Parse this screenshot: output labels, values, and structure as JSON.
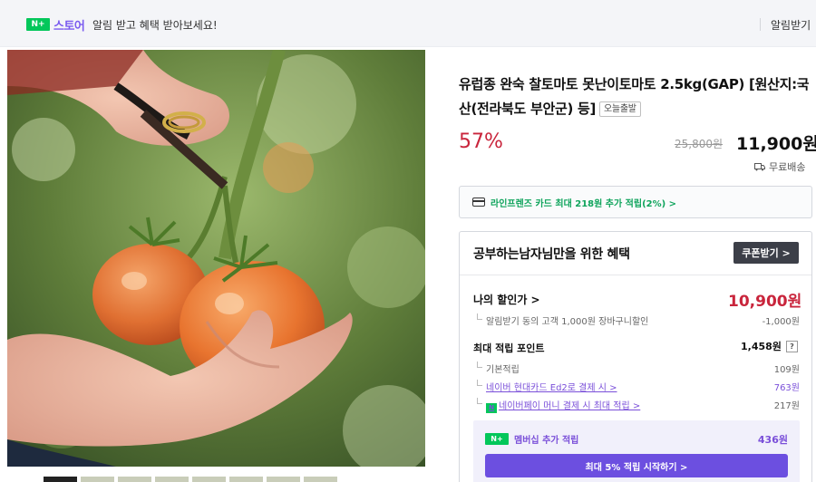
{
  "topbar": {
    "logo_mark": "N+",
    "logo_text": "스토어",
    "message": "알림 받고 혜택 받아보세요!",
    "right_link": "알림받기"
  },
  "product": {
    "title": "유럽종 완숙 찰토마토 못난이토마토 2.5kg(GAP) [원산지:국산(전라북도 부안군) 등]",
    "badge": "오늘출발",
    "discount_rate": "57%",
    "original_price": "25,800원",
    "price": "11,900원",
    "shipping": "무료배송"
  },
  "card_promo": "라인프렌즈 카드 최대 218원 추가 적립(2%) >",
  "benefit": {
    "title": "공부하는남자님만을 위한 혜택",
    "coupon_button": "쿠폰받기 >",
    "my_price_label": "나의 할인가 >",
    "my_price": "10,900원",
    "discount_row": {
      "label": "알림받기 동의 고객 1,000원 장바구니할인",
      "value": "-1,000원"
    },
    "points_label": "최대 적립 포인트",
    "points_total": "1,458원",
    "points_help": "?",
    "point_rows": [
      {
        "label": "기본적립",
        "value": "109원"
      },
      {
        "label": "네이버 현대카드 Ed2로 결제 시 >",
        "value": "763원"
      },
      {
        "label": "네이버페이 머니 결제 시 최대 적립 >",
        "value": "217원"
      }
    ],
    "npay_mini_mark": "N",
    "membership": {
      "mark": "N+",
      "label": "멤버십 추가 적립",
      "points": "436원",
      "button": "최대 5% 적립 시작하기 >"
    }
  },
  "colors": {
    "naver_green": "#03c75a",
    "store_purple": "#7a5bf0",
    "discount_red": "#c9253c",
    "membership_purple": "#6c4fe0"
  },
  "icons": [
    "ticket-icon",
    "card-icon",
    "truck-icon",
    "question-icon"
  ]
}
